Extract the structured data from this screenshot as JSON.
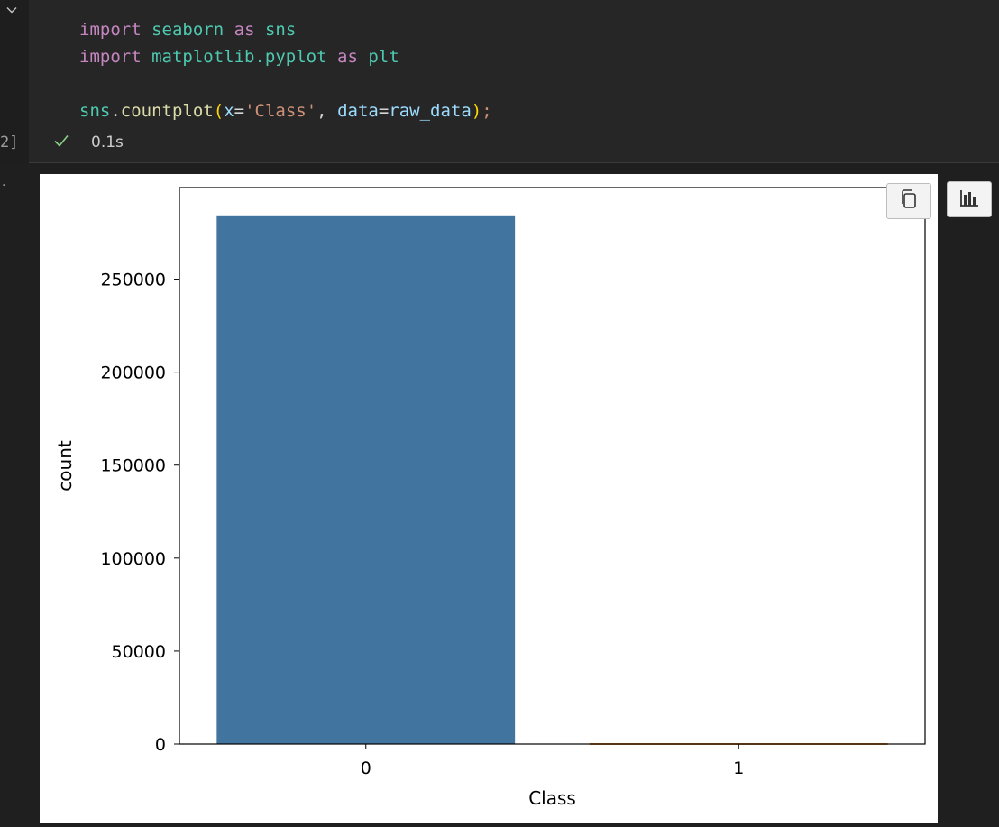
{
  "cell": {
    "code_lines": [
      [
        {
          "t": "import",
          "c": "kw"
        },
        {
          "t": " "
        },
        {
          "t": "seaborn",
          "c": "mod"
        },
        {
          "t": " "
        },
        {
          "t": "as",
          "c": "kw"
        },
        {
          "t": " "
        },
        {
          "t": "sns",
          "c": "mod"
        }
      ],
      [
        {
          "t": "import",
          "c": "kw"
        },
        {
          "t": " "
        },
        {
          "t": "matplotlib.pyplot",
          "c": "mod"
        },
        {
          "t": " "
        },
        {
          "t": "as",
          "c": "kw"
        },
        {
          "t": " "
        },
        {
          "t": "plt",
          "c": "mod"
        }
      ],
      [],
      [
        {
          "t": "sns",
          "c": "mod"
        },
        {
          "t": ".",
          "c": "punc"
        },
        {
          "t": "countplot",
          "c": "fn"
        },
        {
          "t": "(",
          "c": "paren"
        },
        {
          "t": "x",
          "c": "param"
        },
        {
          "t": "=",
          "c": "punc"
        },
        {
          "t": "'Class'",
          "c": "str"
        },
        {
          "t": ", ",
          "c": "punc"
        },
        {
          "t": "data",
          "c": "param"
        },
        {
          "t": "=",
          "c": "punc"
        },
        {
          "t": "raw_data",
          "c": "param"
        },
        {
          "t": ")",
          "c": "paren"
        },
        {
          "t": ";",
          "c": "str"
        }
      ]
    ],
    "execution_count": "2]",
    "status_time": "0.1s"
  },
  "icons": {
    "collapse": "chevron-down-icon",
    "status": "check-icon",
    "copy": "copy-icon",
    "chart": "bar-chart-icon"
  },
  "colors": {
    "bar0": "#4274a0",
    "bar1": "#d8843c"
  },
  "chart_data": {
    "type": "bar",
    "categories": [
      "0",
      "1"
    ],
    "values": [
      284315,
      492
    ],
    "xlabel": "Class",
    "ylabel": "count",
    "ylim": [
      0,
      299255
    ],
    "yticks": [
      0,
      50000,
      100000,
      150000,
      200000,
      250000
    ],
    "grid": false
  }
}
